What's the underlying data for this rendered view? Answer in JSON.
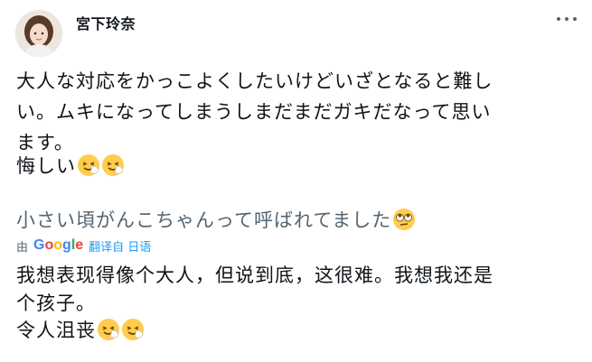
{
  "author": {
    "name": "宮下玲奈",
    "avatar_icon": "profile-photo"
  },
  "menu": {
    "icon": "more-horizontal-icon"
  },
  "tweet": {
    "lines": [
      "大人な対応をかっこよくしたいけどいざとなると難し",
      "い。ムキになってしまうしまだまだガキだなって思い",
      "ます。",
      "悔しい"
    ],
    "second_line": "小さい頃がんこちゃんって呼ばれてました"
  },
  "translation": {
    "by_label": "由",
    "provider_letters": [
      "G",
      "o",
      "o",
      "g",
      "l",
      "e"
    ],
    "provider_colors": [
      "#4285F4",
      "#EA4335",
      "#FBBC05",
      "#4285F4",
      "#34A853",
      "#EA4335"
    ],
    "link_label": "翻译自 日语",
    "lines": [
      "我想表现得像个大人，但说到底，这很难。我想我还是",
      "个孩子。",
      "令人沮丧"
    ]
  },
  "emoji": {
    "tired": "tired-face-emoji",
    "rolling_eyes": "rolling-eyes-emoji"
  }
}
